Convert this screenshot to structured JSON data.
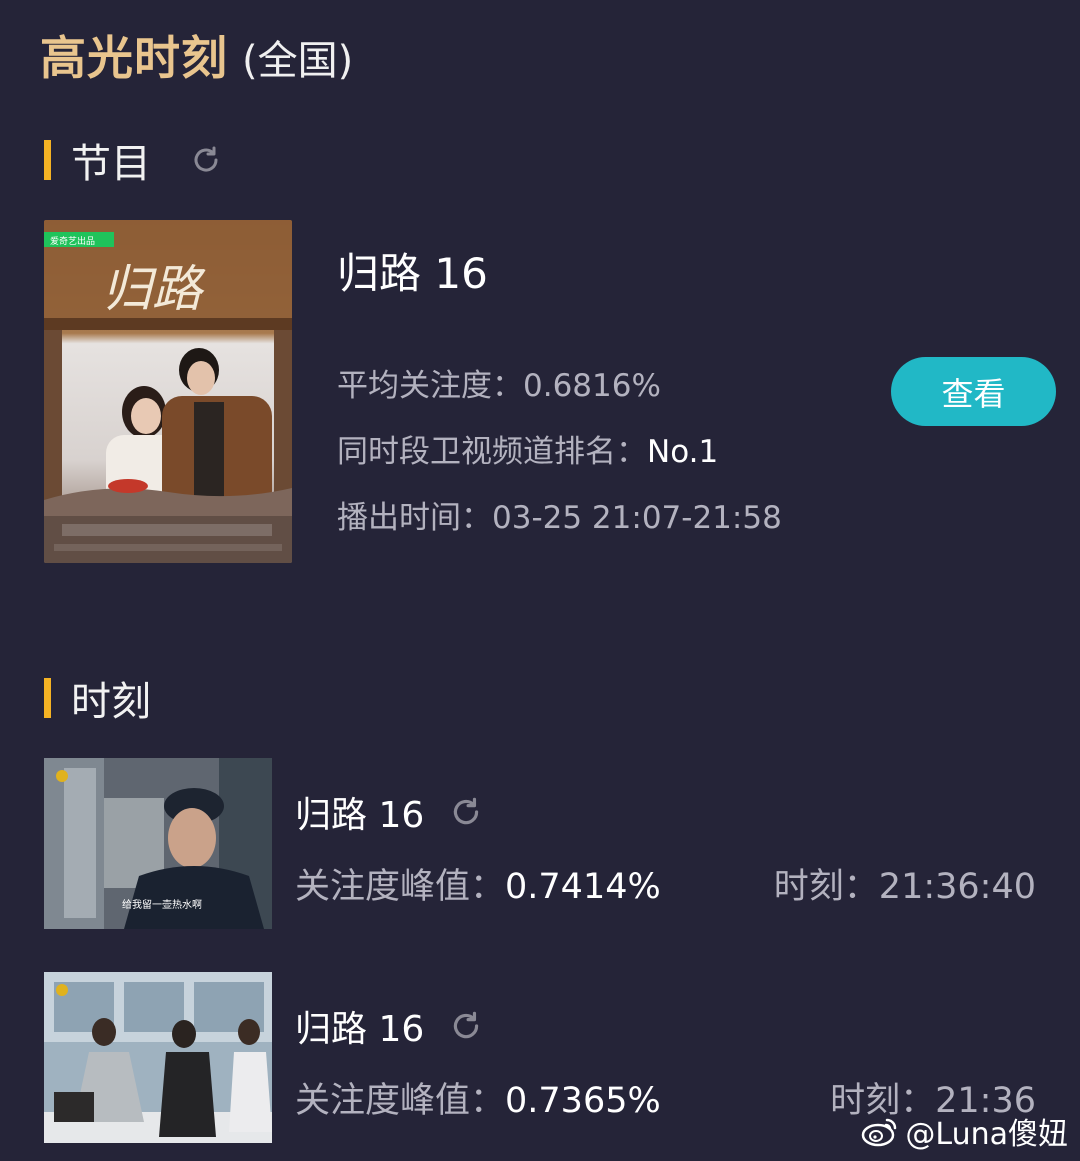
{
  "header": {
    "title": "高光时刻",
    "scope": "(全国)"
  },
  "program_section": {
    "label": "节目",
    "refresh_icon": "refresh-icon",
    "program": {
      "title": "归路 16",
      "poster_title": "归路",
      "poster_badge": "爱奇艺出品",
      "avg_attention_label": "平均关注度：",
      "avg_attention_value": "0.6816%",
      "rank_label": "同时段卫视频道排名：",
      "rank_value": "No.1",
      "airtime_label": "播出时间：",
      "airtime_value": "03-25 21:07-21:58",
      "view_button": "查看"
    }
  },
  "moment_section": {
    "label": "时刻",
    "moments": [
      {
        "title": "归路 16",
        "peak_label": "关注度峰值：",
        "peak_value": "0.7414%",
        "time_label": "时刻：",
        "time_value": "21:36:40",
        "subtitle": "给我留一壶热水啊"
      },
      {
        "title": "归路 16",
        "peak_label": "关注度峰值：",
        "peak_value": "0.7365%",
        "time_label": "时刻：",
        "time_value": "21:36"
      }
    ]
  },
  "watermark": "@Luna傻妞",
  "colors": {
    "background": "#252438",
    "title_gold": "#e9c58e",
    "section_bar": "#f5b324",
    "button": "#21b8c6",
    "muted_text": "#b3b2bf"
  }
}
